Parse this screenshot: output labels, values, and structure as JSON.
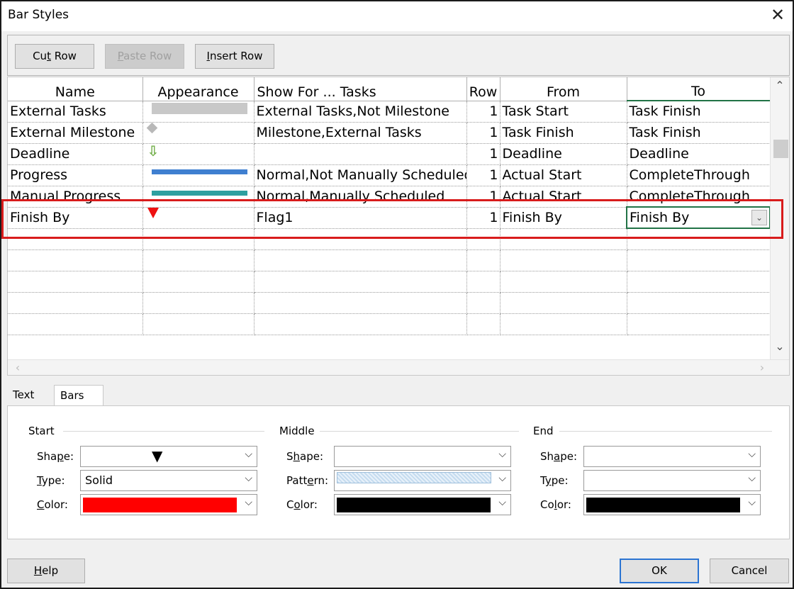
{
  "window": {
    "title": "Bar Styles",
    "close_glyph": "✕"
  },
  "toolbar": {
    "cut_row": {
      "pre": "Cu",
      "u": "t",
      "post": " Row"
    },
    "paste_row": {
      "pre": "",
      "u": "P",
      "post": "aste Row"
    },
    "insert_row": {
      "pre": "",
      "u": "I",
      "post": "nsert Row"
    }
  },
  "grid": {
    "columns": [
      "Name",
      "Appearance",
      "Show For ... Tasks",
      "Row",
      "From",
      "To"
    ],
    "rows": [
      {
        "name": "External Tasks",
        "appearance": "gray-bar-icon",
        "show_for": "External Tasks,Not Milestone",
        "row": "1",
        "from": "Task Start",
        "to": "Task Finish"
      },
      {
        "name": "External Milestone",
        "appearance": "gray-diamond-icon",
        "show_for": "Milestone,External Tasks",
        "row": "1",
        "from": "Task Finish",
        "to": "Task Finish"
      },
      {
        "name": "Deadline",
        "appearance": "green-down-arrow-icon",
        "show_for": "",
        "row": "1",
        "from": "Deadline",
        "to": "Deadline"
      },
      {
        "name": "Progress",
        "appearance": "blue-thin-bar-icon",
        "show_for": "Normal,Not Manually Scheduled",
        "row": "1",
        "from": "Actual Start",
        "to": "CompleteThrough"
      },
      {
        "name": "Manual Progress",
        "appearance": "teal-thin-bar-icon",
        "show_for": "Normal,Manually Scheduled",
        "row": "1",
        "from": "Actual Start",
        "to": "CompleteThrough"
      },
      {
        "name": "Finish By",
        "appearance": "red-triangle-icon",
        "show_for": "Flag1",
        "row": "1",
        "from": "Finish By",
        "to": "Finish By"
      }
    ],
    "selected_to_dropdown": "⌄"
  },
  "tabs": {
    "text": "Text",
    "bars": "Bars"
  },
  "bars_panel": {
    "start": {
      "group": "Start",
      "shape_label": {
        "pre": "Sha",
        "u": "p",
        "post": "e:"
      },
      "type_label": {
        "pre": "",
        "u": "T",
        "post": "ype:"
      },
      "color_label": {
        "pre": "",
        "u": "C",
        "post": "olor:"
      },
      "shape_value": "▼",
      "type_value": "Solid",
      "color_value": "#ff0000"
    },
    "middle": {
      "group": "Middle",
      "shape_label": {
        "pre": "S",
        "u": "h",
        "post": "ape:"
      },
      "pattern_label": {
        "pre": "Patt",
        "u": "e",
        "post": "rn:"
      },
      "color_label": {
        "pre": "C",
        "u": "o",
        "post": "lor:"
      },
      "pattern_color": "#c5dcef",
      "color_value": "#000000"
    },
    "end": {
      "group": "End",
      "shape_label": {
        "pre": "Sh",
        "u": "a",
        "post": "pe:"
      },
      "type_label": {
        "pre": "T",
        "u": "y",
        "post": "pe:"
      },
      "color_label": {
        "pre": "Co",
        "u": "l",
        "post": "or:"
      },
      "color_value": "#000000"
    }
  },
  "footer": {
    "help": {
      "pre": "",
      "u": "H",
      "post": "elp"
    },
    "ok": "OK",
    "cancel": "Cancel"
  },
  "colors": {
    "highlight": "#d81c1c",
    "selection": "#217346",
    "default_button_border": "#2b74d2"
  }
}
